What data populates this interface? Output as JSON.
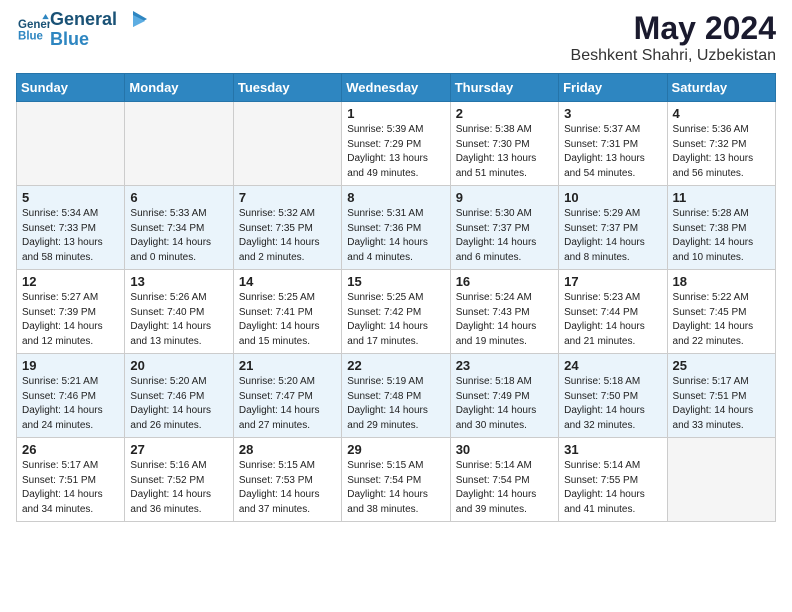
{
  "header": {
    "logo_line1": "General",
    "logo_line2": "Blue",
    "month_year": "May 2024",
    "location": "Beshkent Shahri, Uzbekistan"
  },
  "days_of_week": [
    "Sunday",
    "Monday",
    "Tuesday",
    "Wednesday",
    "Thursday",
    "Friday",
    "Saturday"
  ],
  "weeks": [
    [
      {
        "day": "",
        "info": ""
      },
      {
        "day": "",
        "info": ""
      },
      {
        "day": "",
        "info": ""
      },
      {
        "day": "1",
        "info": "Sunrise: 5:39 AM\nSunset: 7:29 PM\nDaylight: 13 hours\nand 49 minutes."
      },
      {
        "day": "2",
        "info": "Sunrise: 5:38 AM\nSunset: 7:30 PM\nDaylight: 13 hours\nand 51 minutes."
      },
      {
        "day": "3",
        "info": "Sunrise: 5:37 AM\nSunset: 7:31 PM\nDaylight: 13 hours\nand 54 minutes."
      },
      {
        "day": "4",
        "info": "Sunrise: 5:36 AM\nSunset: 7:32 PM\nDaylight: 13 hours\nand 56 minutes."
      }
    ],
    [
      {
        "day": "5",
        "info": "Sunrise: 5:34 AM\nSunset: 7:33 PM\nDaylight: 13 hours\nand 58 minutes."
      },
      {
        "day": "6",
        "info": "Sunrise: 5:33 AM\nSunset: 7:34 PM\nDaylight: 14 hours\nand 0 minutes."
      },
      {
        "day": "7",
        "info": "Sunrise: 5:32 AM\nSunset: 7:35 PM\nDaylight: 14 hours\nand 2 minutes."
      },
      {
        "day": "8",
        "info": "Sunrise: 5:31 AM\nSunset: 7:36 PM\nDaylight: 14 hours\nand 4 minutes."
      },
      {
        "day": "9",
        "info": "Sunrise: 5:30 AM\nSunset: 7:37 PM\nDaylight: 14 hours\nand 6 minutes."
      },
      {
        "day": "10",
        "info": "Sunrise: 5:29 AM\nSunset: 7:37 PM\nDaylight: 14 hours\nand 8 minutes."
      },
      {
        "day": "11",
        "info": "Sunrise: 5:28 AM\nSunset: 7:38 PM\nDaylight: 14 hours\nand 10 minutes."
      }
    ],
    [
      {
        "day": "12",
        "info": "Sunrise: 5:27 AM\nSunset: 7:39 PM\nDaylight: 14 hours\nand 12 minutes."
      },
      {
        "day": "13",
        "info": "Sunrise: 5:26 AM\nSunset: 7:40 PM\nDaylight: 14 hours\nand 13 minutes."
      },
      {
        "day": "14",
        "info": "Sunrise: 5:25 AM\nSunset: 7:41 PM\nDaylight: 14 hours\nand 15 minutes."
      },
      {
        "day": "15",
        "info": "Sunrise: 5:25 AM\nSunset: 7:42 PM\nDaylight: 14 hours\nand 17 minutes."
      },
      {
        "day": "16",
        "info": "Sunrise: 5:24 AM\nSunset: 7:43 PM\nDaylight: 14 hours\nand 19 minutes."
      },
      {
        "day": "17",
        "info": "Sunrise: 5:23 AM\nSunset: 7:44 PM\nDaylight: 14 hours\nand 21 minutes."
      },
      {
        "day": "18",
        "info": "Sunrise: 5:22 AM\nSunset: 7:45 PM\nDaylight: 14 hours\nand 22 minutes."
      }
    ],
    [
      {
        "day": "19",
        "info": "Sunrise: 5:21 AM\nSunset: 7:46 PM\nDaylight: 14 hours\nand 24 minutes."
      },
      {
        "day": "20",
        "info": "Sunrise: 5:20 AM\nSunset: 7:46 PM\nDaylight: 14 hours\nand 26 minutes."
      },
      {
        "day": "21",
        "info": "Sunrise: 5:20 AM\nSunset: 7:47 PM\nDaylight: 14 hours\nand 27 minutes."
      },
      {
        "day": "22",
        "info": "Sunrise: 5:19 AM\nSunset: 7:48 PM\nDaylight: 14 hours\nand 29 minutes."
      },
      {
        "day": "23",
        "info": "Sunrise: 5:18 AM\nSunset: 7:49 PM\nDaylight: 14 hours\nand 30 minutes."
      },
      {
        "day": "24",
        "info": "Sunrise: 5:18 AM\nSunset: 7:50 PM\nDaylight: 14 hours\nand 32 minutes."
      },
      {
        "day": "25",
        "info": "Sunrise: 5:17 AM\nSunset: 7:51 PM\nDaylight: 14 hours\nand 33 minutes."
      }
    ],
    [
      {
        "day": "26",
        "info": "Sunrise: 5:17 AM\nSunset: 7:51 PM\nDaylight: 14 hours\nand 34 minutes."
      },
      {
        "day": "27",
        "info": "Sunrise: 5:16 AM\nSunset: 7:52 PM\nDaylight: 14 hours\nand 36 minutes."
      },
      {
        "day": "28",
        "info": "Sunrise: 5:15 AM\nSunset: 7:53 PM\nDaylight: 14 hours\nand 37 minutes."
      },
      {
        "day": "29",
        "info": "Sunrise: 5:15 AM\nSunset: 7:54 PM\nDaylight: 14 hours\nand 38 minutes."
      },
      {
        "day": "30",
        "info": "Sunrise: 5:14 AM\nSunset: 7:54 PM\nDaylight: 14 hours\nand 39 minutes."
      },
      {
        "day": "31",
        "info": "Sunrise: 5:14 AM\nSunset: 7:55 PM\nDaylight: 14 hours\nand 41 minutes."
      },
      {
        "day": "",
        "info": ""
      }
    ]
  ]
}
